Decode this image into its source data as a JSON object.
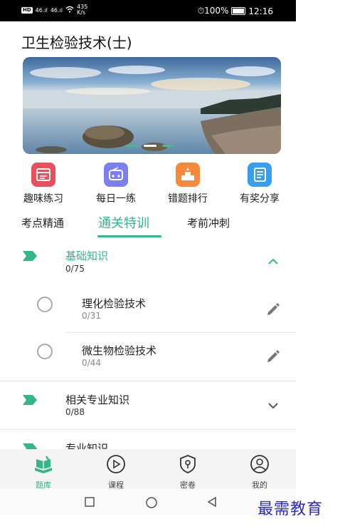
{
  "status_bar": {
    "net_tag": "HD",
    "signal1": "46.ıl",
    "signal2": "46.ıl",
    "speed_value": "435",
    "speed_unit": "K/s",
    "alarm_battery": "⏱100%",
    "time": "12:16"
  },
  "page_title": "卫生检验技术(士)",
  "banner": {
    "slide_index": 2,
    "slide_count": 3
  },
  "quick_actions": [
    {
      "label": "趣味练习",
      "icon": "calendar-list-icon",
      "color": "#e8505b"
    },
    {
      "label": "每日一练",
      "icon": "radio-icon",
      "color": "#7b7ff0"
    },
    {
      "label": "错题排行",
      "icon": "podium-icon",
      "color": "#f58a3c"
    },
    {
      "label": "有奖分享",
      "icon": "notebook-icon",
      "color": "#3a9ef0"
    }
  ],
  "tabs": [
    {
      "label": "考点精通",
      "active": false
    },
    {
      "label": "通关特训",
      "active": true
    },
    {
      "label": "考前冲刺",
      "active": false
    }
  ],
  "sections": [
    {
      "title": "基础知识",
      "count": "0/75",
      "expanded": true,
      "items": [
        {
          "title": "理化检验技术",
          "count": "0/31"
        },
        {
          "title": "微生物检验技术",
          "count": "0/44"
        }
      ]
    },
    {
      "title": "相关专业知识",
      "count": "0/88",
      "expanded": false
    },
    {
      "title": "专业知识",
      "count": "",
      "expanded": false
    }
  ],
  "bottom_nav": [
    {
      "label": "题库",
      "icon": "books-icon",
      "active": true
    },
    {
      "label": "课程",
      "icon": "play-circle-icon",
      "active": false
    },
    {
      "label": "密卷",
      "icon": "shield-lock-icon",
      "active": false
    },
    {
      "label": "我的",
      "icon": "user-circle-icon",
      "active": false
    }
  ],
  "accent_color": "#35b58a",
  "watermark": "最需教育"
}
